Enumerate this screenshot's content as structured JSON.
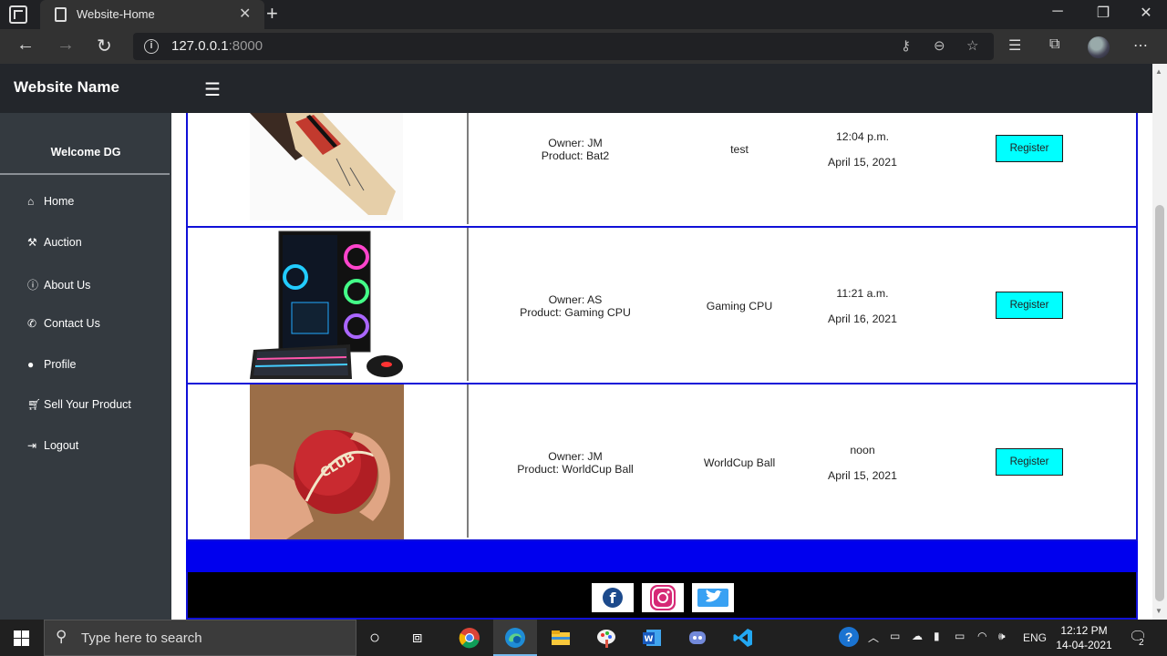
{
  "browser": {
    "tab_title": "Website-Home",
    "url_host": "127.0.0.1",
    "url_port": ":8000"
  },
  "site": {
    "name": "Website Name",
    "welcome": "Welcome DG"
  },
  "sidebar": {
    "items": [
      {
        "label": "Home",
        "icon": "home-icon"
      },
      {
        "label": "Auction",
        "icon": "gavel-icon"
      },
      {
        "label": "About Us",
        "icon": "info-icon"
      },
      {
        "label": "Contact Us",
        "icon": "phone-icon"
      },
      {
        "label": "Profile",
        "icon": "user-icon"
      },
      {
        "label": "Sell Your Product",
        "icon": "cart-icon"
      },
      {
        "label": "Logout",
        "icon": "logout-icon"
      }
    ]
  },
  "products": [
    {
      "owner": "Owner: JM",
      "product": "Product: Bat2",
      "name": "test",
      "time": "12:04 p.m.",
      "date": "April 15, 2021",
      "button": "Register"
    },
    {
      "owner": "Owner: AS",
      "product": "Product: Gaming CPU",
      "name": "Gaming CPU",
      "time": "11:21 a.m.",
      "date": "April 16, 2021",
      "button": "Register"
    },
    {
      "owner": "Owner: JM",
      "product": "Product: WorldCup Ball",
      "name": "WorldCup Ball",
      "time": "noon",
      "date": "April 15, 2021",
      "button": "Register"
    }
  ],
  "footer": {
    "social": [
      "facebook-icon",
      "instagram-icon",
      "twitter-icon"
    ]
  },
  "taskbar": {
    "search_placeholder": "Type here to search",
    "language": "ENG",
    "time": "12:12 PM",
    "date": "14-04-2021",
    "notification_count": "2"
  },
  "colors": {
    "border_blue": "#1010d8",
    "band_blue": "#0000ee",
    "button_cyan": "#00ffff",
    "sidebar_bg": "#343a40",
    "header_bg": "#23262b"
  }
}
